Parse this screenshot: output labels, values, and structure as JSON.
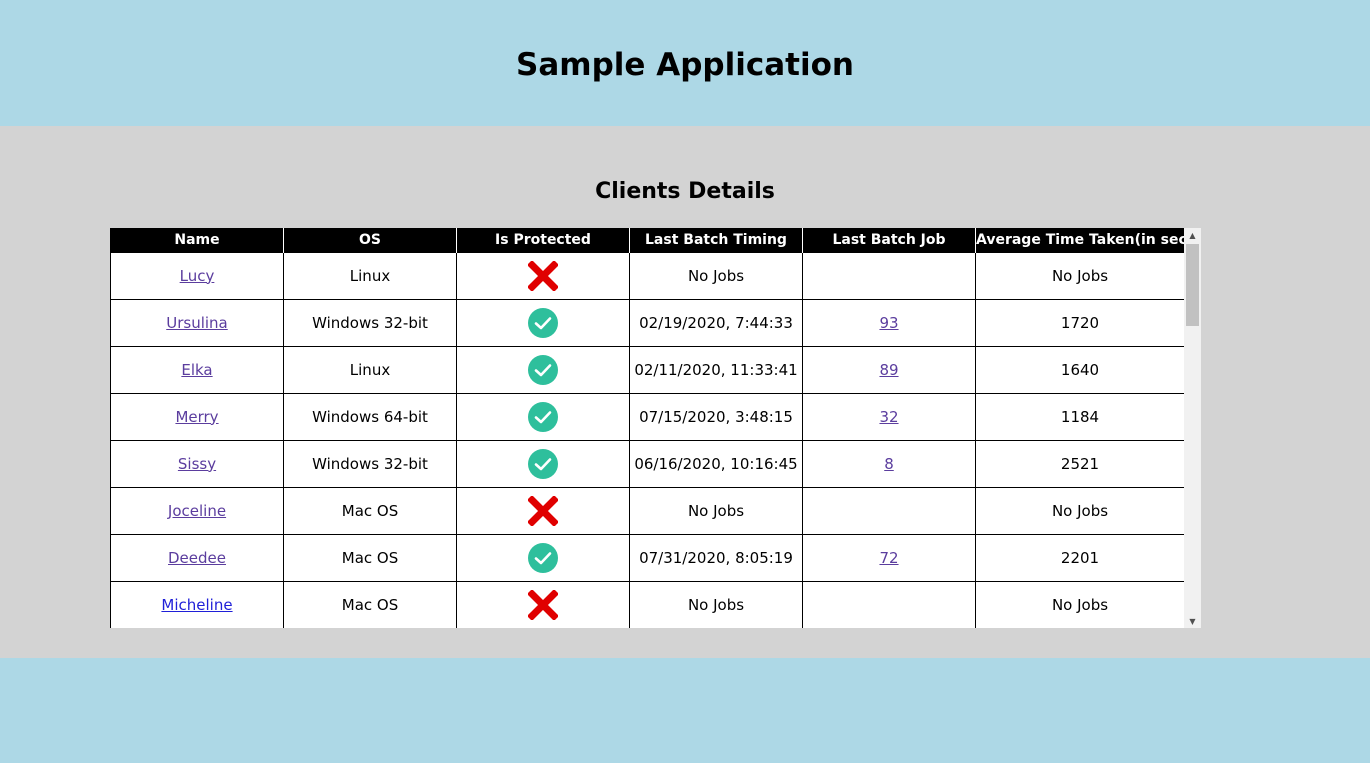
{
  "app": {
    "title": "Sample Application"
  },
  "section": {
    "title": "Clients Details"
  },
  "table": {
    "columns": [
      "Name",
      "OS",
      "Is Protected",
      "Last Batch Timing",
      "Last Batch Job",
      "Average Time Taken(in sec)"
    ],
    "rows": [
      {
        "name": "Lucy",
        "os": "Linux",
        "protected": false,
        "timing": "No Jobs",
        "job": "",
        "avg": "No Jobs"
      },
      {
        "name": "Ursulina",
        "os": "Windows 32-bit",
        "protected": true,
        "timing": "02/19/2020, 7:44:33",
        "job": "93",
        "avg": "1720"
      },
      {
        "name": "Elka",
        "os": "Linux",
        "protected": true,
        "timing": "02/11/2020, 11:33:41",
        "job": "89",
        "avg": "1640"
      },
      {
        "name": "Merry",
        "os": "Windows 64-bit",
        "protected": true,
        "timing": "07/15/2020, 3:48:15",
        "job": "32",
        "avg": "1184"
      },
      {
        "name": "Sissy",
        "os": "Windows 32-bit",
        "protected": true,
        "timing": "06/16/2020, 10:16:45",
        "job": "8",
        "avg": "2521"
      },
      {
        "name": "Joceline",
        "os": "Mac OS",
        "protected": false,
        "timing": "No Jobs",
        "job": "",
        "avg": "No Jobs"
      },
      {
        "name": "Deedee",
        "os": "Mac OS",
        "protected": true,
        "timing": "07/31/2020, 8:05:19",
        "job": "72",
        "avg": "2201"
      },
      {
        "name": "Micheline",
        "os": "Mac OS",
        "protected": false,
        "timing": "No Jobs",
        "job": "",
        "avg": "No Jobs"
      }
    ]
  },
  "icons": {
    "protected": "check-circle-icon",
    "unprotected": "red-x-icon"
  },
  "colors": {
    "page_background": "#add8e6",
    "content_background": "#d3d3d3",
    "header_row": "#000000",
    "check": "#2ebf9c",
    "cross": "#e00000",
    "visited_link": "#5b3d9e",
    "link": "#1f1fd8"
  },
  "scroll": {
    "thumb_position": 0.0,
    "visible_fraction": 0.2
  }
}
